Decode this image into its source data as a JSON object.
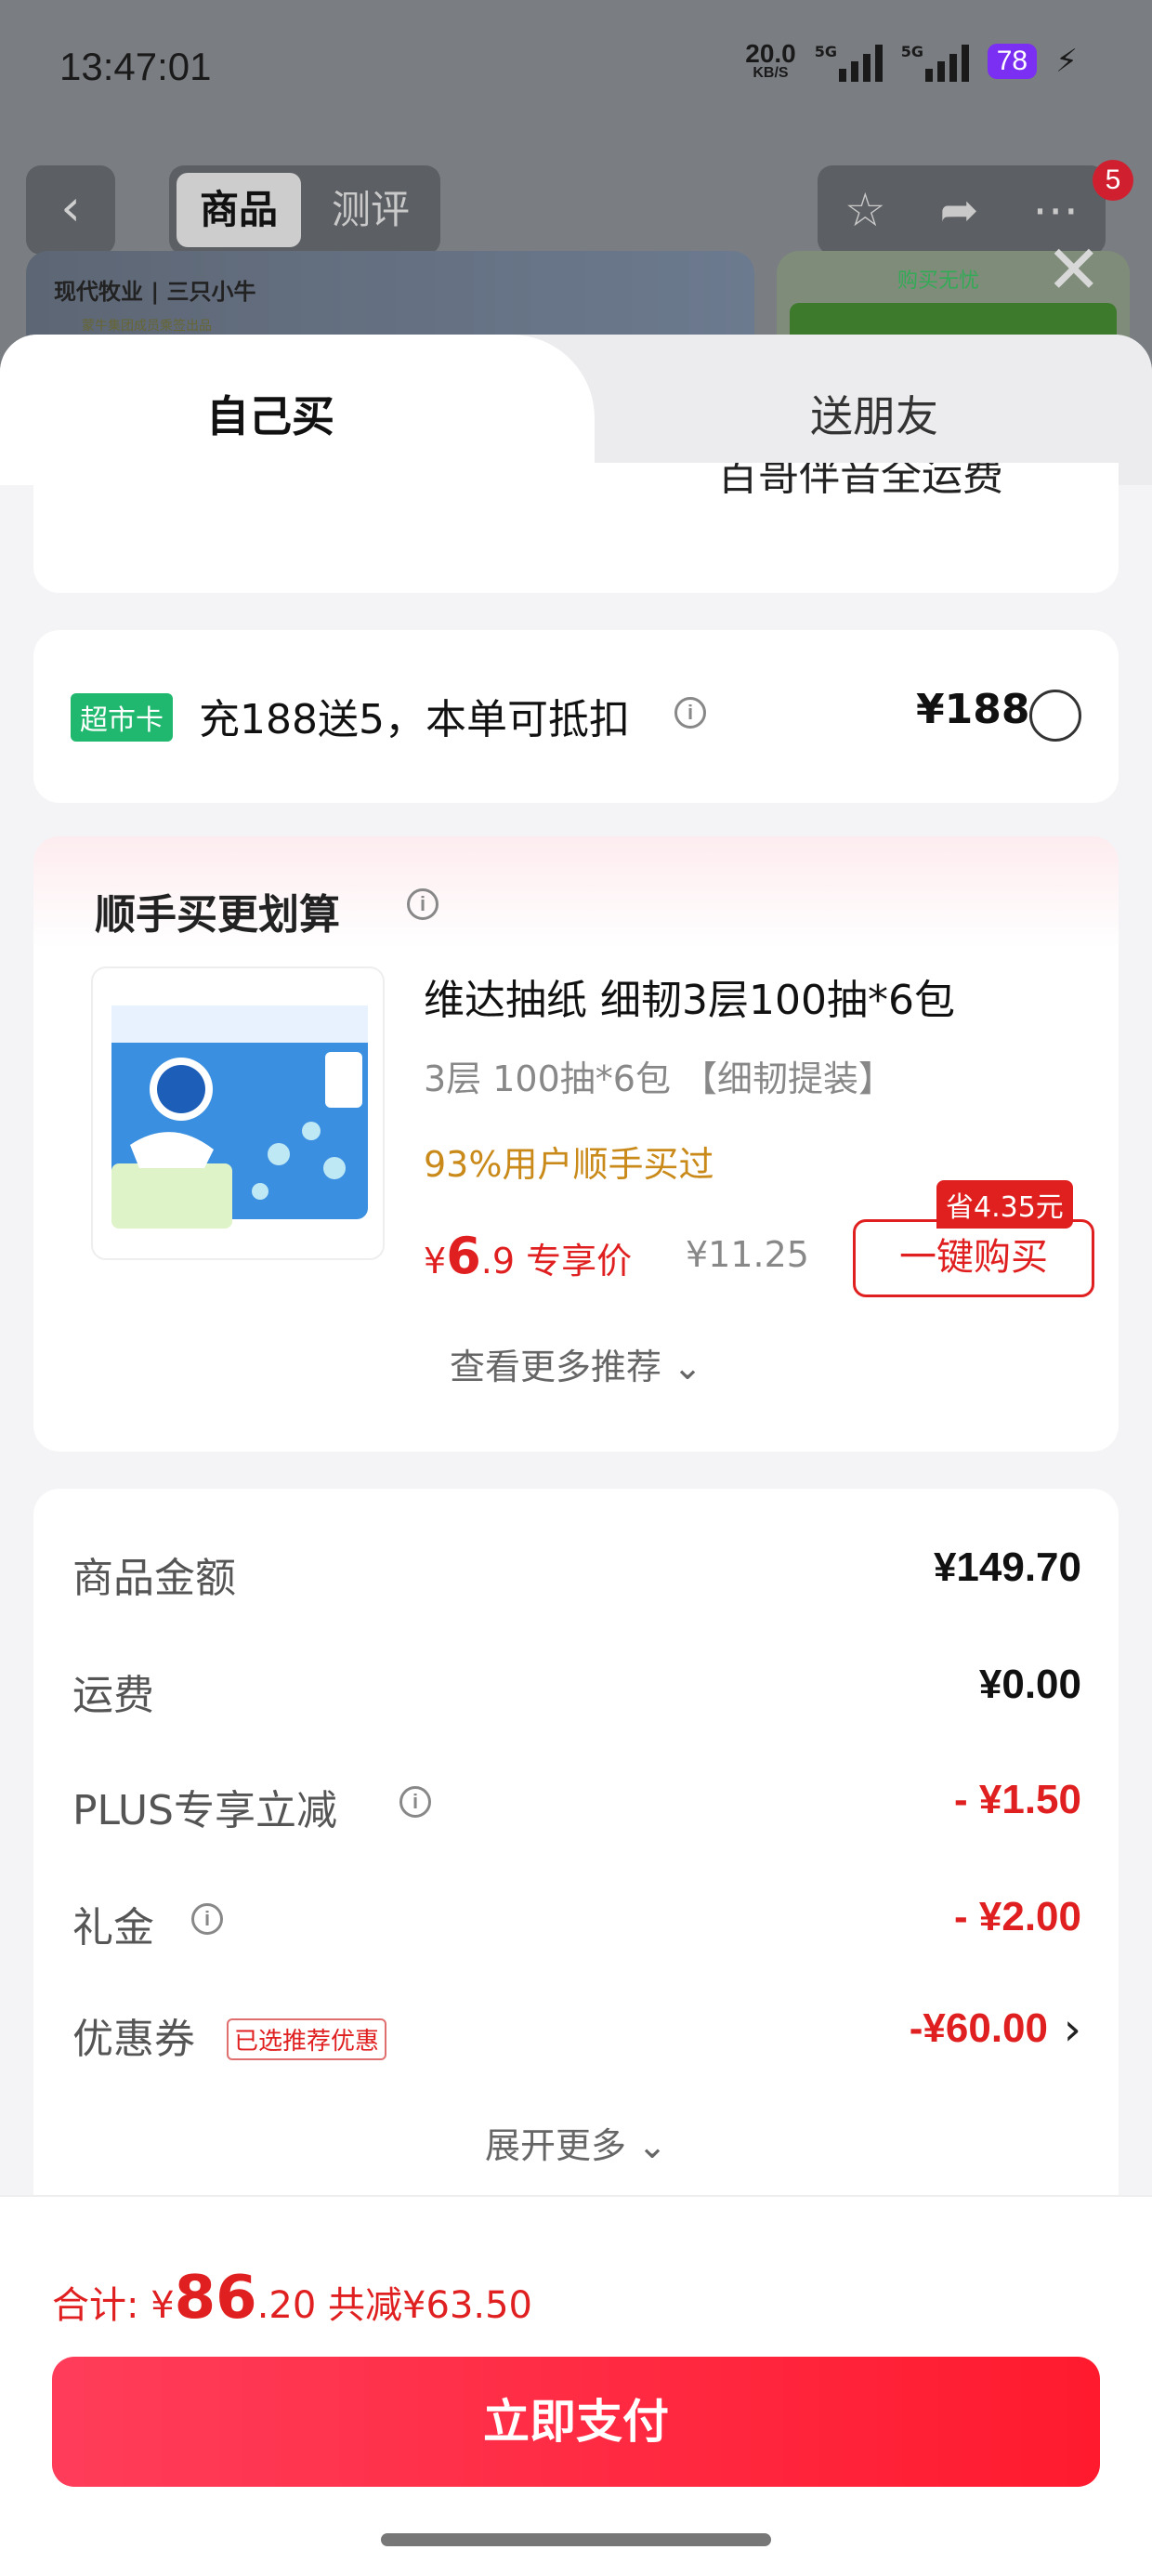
{
  "status": {
    "time": "13:47:01",
    "net_speed": "20.0",
    "net_unit": "KB/S",
    "sig1": "5G",
    "sig2": "5G",
    "battery": "78"
  },
  "bg": {
    "tab_goods": "商品",
    "tab_review": "测评",
    "cart_count": "5",
    "banner_logo": "现代牧业 | 三只小牛",
    "banner_sub": "蒙牛集团成员乘签出品",
    "right_title": "购买无忧"
  },
  "sheet": {
    "tab_self": "自己买",
    "tab_friend": "送朋友",
    "partial_text": "百哥伴音全运费",
    "supercard": {
      "chip": "超市卡",
      "text": "充188送5，本单可抵扣",
      "price": "¥188"
    },
    "addon": {
      "title": "顺手买更划算",
      "product_name": "维达抽纸 细韧3层100抽*6包",
      "product_spec": "3层 100抽*6包 【细韧提装】",
      "product_hint": "93%用户顺手买过",
      "price_symbol": "¥",
      "price_int": "6",
      "price_dec": ".9",
      "price_label": "专享价",
      "old_price": "¥11.25",
      "save_tag": "省4.35元",
      "buy_btn": "一键购买",
      "more": "查看更多推荐 ⌄"
    },
    "summary": {
      "rows": [
        {
          "label": "商品金额",
          "value": "¥149.70"
        },
        {
          "label": "运费",
          "value": "¥0.00"
        },
        {
          "label": "PLUS专享立减",
          "value": "- ¥1.50"
        },
        {
          "label": "礼金",
          "value": "- ¥2.00"
        },
        {
          "label": "优惠券",
          "value": "-¥60.00"
        }
      ],
      "coupon_tag": "已选推荐优惠",
      "expand": "展开更多 ⌄"
    },
    "footer": {
      "total_label": "合计: ¥",
      "total_int": "86",
      "total_dec": ".20",
      "saved": " 共减¥63.50",
      "pay_btn": "立即支付"
    }
  },
  "colors": {
    "accent_red": "#e02020",
    "supercard_green": "#1fb86e",
    "pay_gradient_start": "#ff3d5a",
    "pay_gradient_end": "#ff1a2e",
    "hint_orange": "#c98a1a"
  }
}
